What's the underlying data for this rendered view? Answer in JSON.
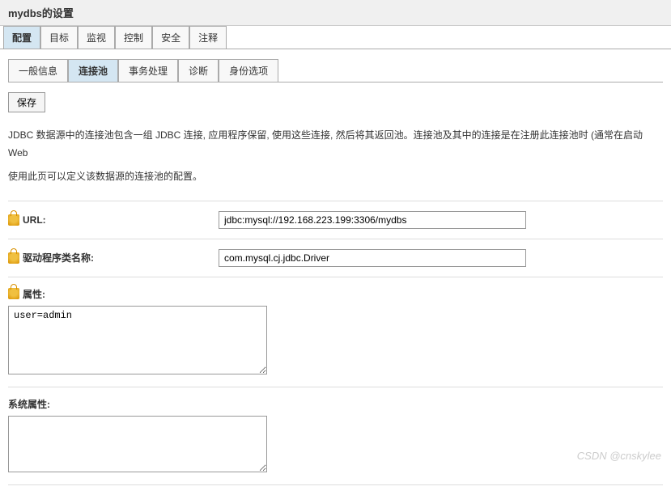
{
  "page_title": "mydbs的设置",
  "main_tabs": [
    {
      "label": "配置",
      "active": true
    },
    {
      "label": "目标",
      "active": false
    },
    {
      "label": "监视",
      "active": false
    },
    {
      "label": "控制",
      "active": false
    },
    {
      "label": "安全",
      "active": false
    },
    {
      "label": "注释",
      "active": false
    }
  ],
  "sub_tabs": [
    {
      "label": "一般信息",
      "active": false
    },
    {
      "label": "连接池",
      "active": true
    },
    {
      "label": "事务处理",
      "active": false
    },
    {
      "label": "诊断",
      "active": false
    },
    {
      "label": "身份选项",
      "active": false
    }
  ],
  "save_button": "保存",
  "description_line1": "JDBC 数据源中的连接池包含一组 JDBC 连接, 应用程序保留, 使用这些连接, 然后将其返回池。连接池及其中的连接是在注册此连接池时 (通常在启动 Web",
  "description_line2": "使用此页可以定义该数据源的连接池的配置。",
  "form": {
    "url_label": "URL:",
    "url_value": "jdbc:mysql://192.168.223.199:3306/mydbs",
    "driver_label": "驱动程序类名称:",
    "driver_value": "com.mysql.cj.jdbc.Driver",
    "properties_label": "属性:",
    "properties_value": "user=admin",
    "system_properties_label": "系统属性:",
    "system_properties_value": ""
  },
  "watermark": "CSDN @cnskylee"
}
